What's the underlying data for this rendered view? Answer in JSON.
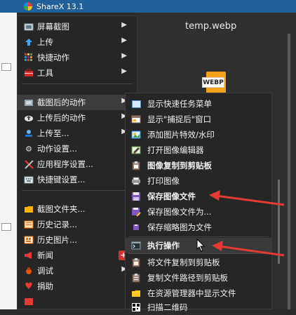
{
  "window": {
    "title": "ShareX 13.1"
  },
  "preview": {
    "filename": "temp.webp",
    "badge_text": "WEBP"
  },
  "main_menu": {
    "items": [
      {
        "label": "屏幕截图",
        "icon": "screenshot-icon",
        "submenu": true
      },
      {
        "label": "上传",
        "icon": "upload-arrow-icon",
        "submenu": true
      },
      {
        "label": "快捷动作",
        "icon": "quick-actions-icon",
        "submenu": true
      },
      {
        "label": "工具",
        "icon": "toolbox-icon",
        "submenu": true
      },
      {
        "label": "截图后的动作",
        "icon": "after-capture-icon",
        "submenu": true,
        "highlighted": true
      },
      {
        "label": "上传后的动作",
        "icon": "cloud-upload-icon",
        "submenu": true
      },
      {
        "label": "上传至...",
        "icon": "upload-destination-icon",
        "submenu": true
      },
      {
        "label": "动作设置...",
        "icon": "gear-icon",
        "submenu": false
      },
      {
        "label": "应用程序设置...",
        "icon": "tools-icon",
        "submenu": false
      },
      {
        "label": "快捷键设置...",
        "icon": "keyboard-icon",
        "submenu": false
      },
      {
        "label": "截图文件夹...",
        "icon": "folder-icon",
        "submenu": false
      },
      {
        "label": "历史记录...",
        "icon": "history-icon",
        "submenu": false
      },
      {
        "label": "历史图片...",
        "icon": "image-history-icon",
        "submenu": false
      },
      {
        "label": "新闻",
        "icon": "megaphone-icon",
        "submenu": false,
        "badge": "+"
      },
      {
        "label": "调试",
        "icon": "bug-icon",
        "submenu": true
      },
      {
        "label": "捐助",
        "icon": "heart-icon",
        "submenu": false
      }
    ]
  },
  "sub_menu": {
    "items": [
      {
        "label": "显示快速任务菜单",
        "icon": "task-menu-icon",
        "bold": false
      },
      {
        "label": "显示\"捕捉后\"窗口",
        "icon": "window-icon",
        "bold": false
      },
      {
        "label": "添加图片特效/水印",
        "icon": "effects-icon",
        "bold": false
      },
      {
        "label": "打开图像编辑器",
        "icon": "image-editor-icon",
        "bold": false
      },
      {
        "label": "图像复制到剪贴板",
        "icon": "clipboard-image-icon",
        "bold": true
      },
      {
        "label": "打印图像",
        "icon": "printer-icon",
        "bold": false
      },
      {
        "label": "保存图像文件",
        "icon": "save-icon",
        "bold": true
      },
      {
        "label": "保存图像文件为...",
        "icon": "save-as-icon",
        "bold": false
      },
      {
        "label": "保存缩略图为文件",
        "icon": "thumbnail-icon",
        "bold": false
      },
      {
        "label": "执行操作",
        "icon": "terminal-icon",
        "bold": true,
        "highlighted": true
      },
      {
        "label": "将文件复制到剪贴板",
        "icon": "copy-file-icon",
        "bold": false
      },
      {
        "label": "复制文件路径到剪贴板",
        "icon": "copy-path-icon",
        "bold": false
      },
      {
        "label": "在资源管理器中显示文件",
        "icon": "explorer-folder-icon",
        "bold": false
      },
      {
        "label": "扫描二维码",
        "icon": "qr-code-icon",
        "bold": false
      }
    ]
  },
  "colors": {
    "annotation_arrow": "#e53935",
    "titlebar": "#1f5f9a"
  }
}
